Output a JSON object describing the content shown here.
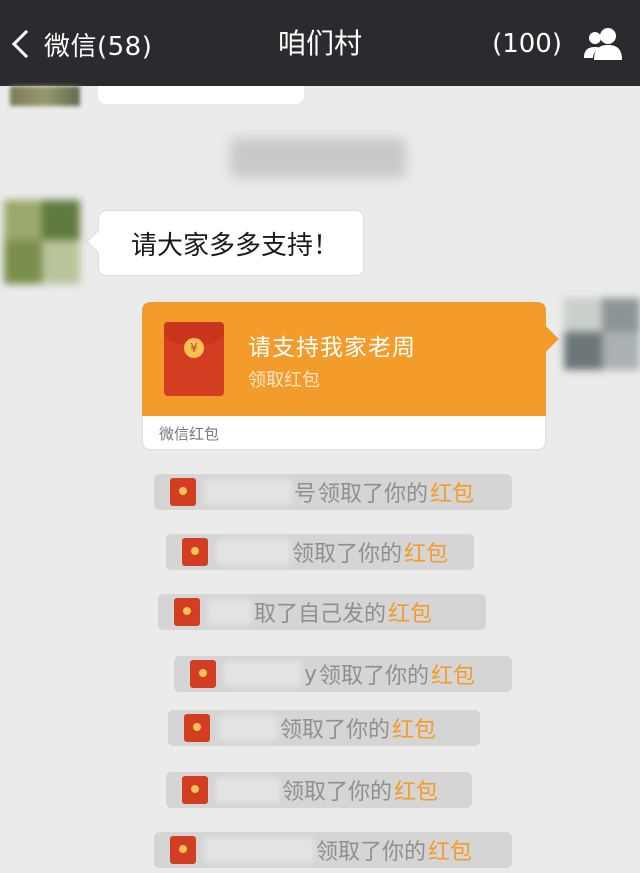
{
  "navbar": {
    "back_label": "微信(58)",
    "title": "咱们村",
    "member_count": "(100)",
    "members_icon": "group-members-icon"
  },
  "messages": {
    "text_bubble": "请大家多多支持！"
  },
  "red_packet": {
    "title": "请支持我家老周",
    "action": "领取红包",
    "footer": "微信红包",
    "color": "#f39c2b"
  },
  "notices": [
    {
      "prefix": "号",
      "text": "领取了你的",
      "link": "红包"
    },
    {
      "prefix": "",
      "text": "领取了你的",
      "link": "红包"
    },
    {
      "prefix": "",
      "text": "取了自己发的",
      "link": "红包"
    },
    {
      "prefix": "y",
      "text": "领取了你的",
      "link": "红包"
    },
    {
      "prefix": "",
      "text": "领取了你的",
      "link": "红包"
    },
    {
      "prefix": "",
      "text": "领取了你的",
      "link": "红包"
    },
    {
      "prefix": "",
      "text": "领取了你的",
      "link": "红包"
    }
  ]
}
